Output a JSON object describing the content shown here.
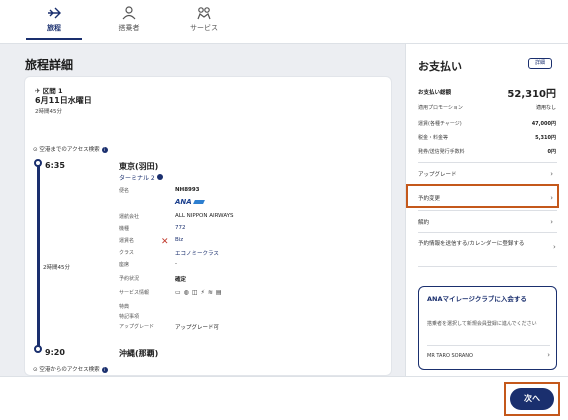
{
  "tabs": [
    {
      "label": "旅程",
      "icon": "plane-icon",
      "active": true
    },
    {
      "label": "搭乗者",
      "icon": "person-icon",
      "active": false
    },
    {
      "label": "サービス",
      "icon": "service-icon",
      "active": false
    }
  ],
  "main": {
    "title": "旅程詳細",
    "segment": {
      "label": "区間 1",
      "date": "6月11日水曜日",
      "duration": "2時間45分",
      "access_before": "空港までのアクセス検索",
      "access_after": "空港からのアクセス検索",
      "departure": {
        "time": "6:35",
        "airport": "東京(羽田)",
        "terminal": "ターミナル 2"
      },
      "arrival": {
        "time": "9:20",
        "airport": "沖縄(那覇)"
      },
      "mid_duration": "2時間45分",
      "fields": [
        {
          "label": "便名",
          "value": "NH8993"
        },
        {
          "label": "運航会社",
          "value": "ALL NIPPON AIRWAYS"
        },
        {
          "label": "機種",
          "value": "772"
        },
        {
          "label": "運賃名",
          "value": "Biz"
        },
        {
          "label": "クラス",
          "value": "エコノミークラス"
        },
        {
          "label": "座席",
          "value": "-"
        },
        {
          "label": "予約状況",
          "value": "確定"
        },
        {
          "label": "サービス情報",
          "value": ""
        },
        {
          "label": "特典",
          "value": ""
        },
        {
          "label": "特記事項",
          "value": ""
        },
        {
          "label": "アップグレード",
          "value": "アップグレード可"
        }
      ],
      "airline_logo": "ANA"
    }
  },
  "payment": {
    "title": "お支払い",
    "detail_button": "詳細",
    "total_label": "お支払い総額",
    "total_value": "52,310円",
    "rows": [
      {
        "label": "適用プロモーション",
        "value": "適用なし"
      },
      {
        "label": "運賃(各種チャージ)",
        "value": "47,000円"
      },
      {
        "label": "税金・料金等",
        "value": "5,310円"
      },
      {
        "label": "発券/送信発行手数料",
        "value": "0円"
      }
    ],
    "menu": [
      {
        "label": "アップグレード"
      },
      {
        "label": "予約変更"
      },
      {
        "label": "解約"
      },
      {
        "label": "予約情報を送信する/カレンダーに登録する"
      }
    ],
    "mileage": {
      "title": "ANAマイレージクラブに入会する",
      "desc": "搭乗者を選択して新規会員登録に進んでください",
      "name": "MR TARO SORANO"
    }
  },
  "footer": {
    "next": "次へ"
  },
  "colors": {
    "brand": "#1a2f6e",
    "highlight": "#c4581b"
  }
}
